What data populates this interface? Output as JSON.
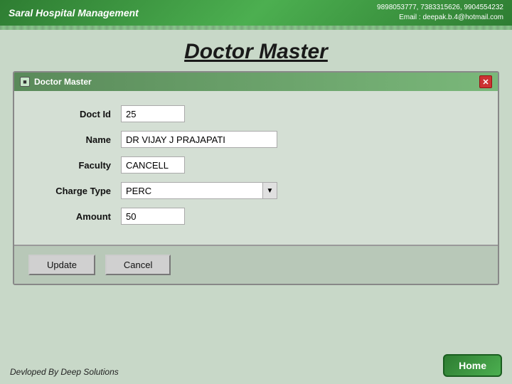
{
  "header": {
    "app_title": "Saral Hospital Management",
    "contact_line1": "9898053777, 7383315626, 9904554232",
    "contact_line2": "Email : deepak.b.4@hotmail.com"
  },
  "page": {
    "title": "Doctor Master"
  },
  "dialog": {
    "title": "Doctor Master",
    "icon_label": "■",
    "close_label": "✕"
  },
  "form": {
    "doct_id_label": "Doct Id",
    "doct_id_value": "25",
    "name_label": "Name",
    "name_value": "DR VIJAY J PRAJAPATI",
    "faculty_label": "Faculty",
    "faculty_value": "CANCELL",
    "charge_type_label": "Charge Type",
    "charge_type_value": "PERC",
    "amount_label": "Amount",
    "amount_value": "50"
  },
  "buttons": {
    "update_label": "Update",
    "cancel_label": "Cancel"
  },
  "footer": {
    "dev_text": "Devloped By Deep Solutions",
    "home_label": "Home"
  }
}
